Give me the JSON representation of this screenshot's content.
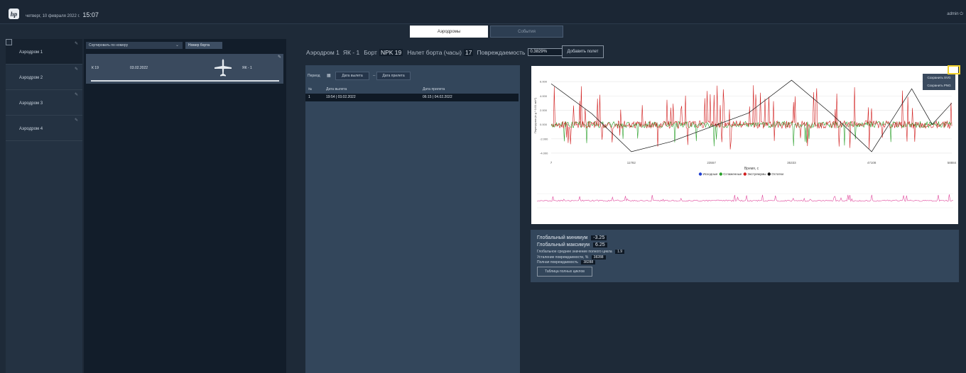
{
  "app": {
    "logo": "hp",
    "date": "четверг, 10 февраля 2022 г.",
    "time": "15:07",
    "user": "admin",
    "user_icon": "power-icon"
  },
  "tabs": [
    {
      "label": "Аэродромы",
      "active": true
    },
    {
      "label": "События",
      "active": false
    }
  ],
  "sidebar": {
    "items": [
      {
        "label": "Аэродром 1",
        "active": true
      },
      {
        "label": "Аэродром 2",
        "active": false
      },
      {
        "label": "Аэродром 3",
        "active": false
      },
      {
        "label": "Аэродром 4",
        "active": false
      }
    ],
    "edit_icon": "edit-icon"
  },
  "flights_list": {
    "sort_select": "Сортировать по номеру",
    "board_button": "Номер борта",
    "card": {
      "board": "К 19",
      "date": "03.02.2022",
      "type": "ЯК - 1"
    }
  },
  "header": {
    "airport": "Аэродром 1",
    "aircraft": "ЯК - 1",
    "board_label": "Борт",
    "board_value": "NPK 19",
    "hours_label": "Налет борта (часы)",
    "hours_value": "17",
    "damage_label": "Повреждаемость",
    "damage_value": "0.3829%",
    "add_button": "Добавить полет"
  },
  "flight_table": {
    "period_label": "Период",
    "from_button": "Дата вылета",
    "to_button": "Дата прилета",
    "dash": "–",
    "columns": [
      "№",
      "Дата вылета",
      "Дата прилета"
    ],
    "rows": [
      {
        "n": "1",
        "departure": "19:54 | 03.02.2022",
        "arrival": "06:15 | 04.02.2022"
      }
    ]
  },
  "chart_data": {
    "type": "line",
    "xlabel": "Время, с",
    "ylabel": "Перегрузка (в g * 0.01 м/с²)",
    "x_ticks": [
      "7",
      "11782",
      "23557",
      "35333",
      "47108",
      "58884"
    ],
    "y_ticks": [
      "6.000",
      "4.000",
      "2.000",
      "0.000",
      "-2.000",
      "-4.000"
    ],
    "ylim": [
      -4.5,
      7
    ],
    "xlim": [
      7,
      58884
    ],
    "grid": true,
    "legend_position": "bottom",
    "legend": [
      {
        "name": "Исходные",
        "color": "#1f3fd1"
      },
      {
        "name": "Сглаженные",
        "color": "#2aa02a"
      },
      {
        "name": "Экстремумы",
        "color": "#d11f1f"
      },
      {
        "name": "Остатки",
        "color": "#111111"
      }
    ],
    "residuals_polyline": {
      "x": [
        7,
        6000,
        11782,
        17600,
        29000,
        35333,
        41200,
        47108,
        53000,
        56000,
        58884
      ],
      "y": [
        5.7,
        1.5,
        -3.8,
        -2.4,
        1.6,
        6.2,
        1.5,
        -3.8,
        5.0,
        0.0,
        3.0
      ]
    },
    "menu": [
      "Сохранить SVG",
      "Сохранить PNG"
    ]
  },
  "stats": {
    "global_min_label": "Глобальный минимум",
    "global_min": "-3.25",
    "global_max_label": "Глобальный максимум",
    "global_max": "6.25",
    "mean_cycles_label": "Глобальное среднее значение полного цикла",
    "mean_cycles": "1.9",
    "fatigue_label": "Усталение повреждаемости, %",
    "fatigue": "38288",
    "damage_label": "Полная повреждаемость",
    "damage": "38288",
    "cycles_button": "Таблица полных циклов"
  }
}
